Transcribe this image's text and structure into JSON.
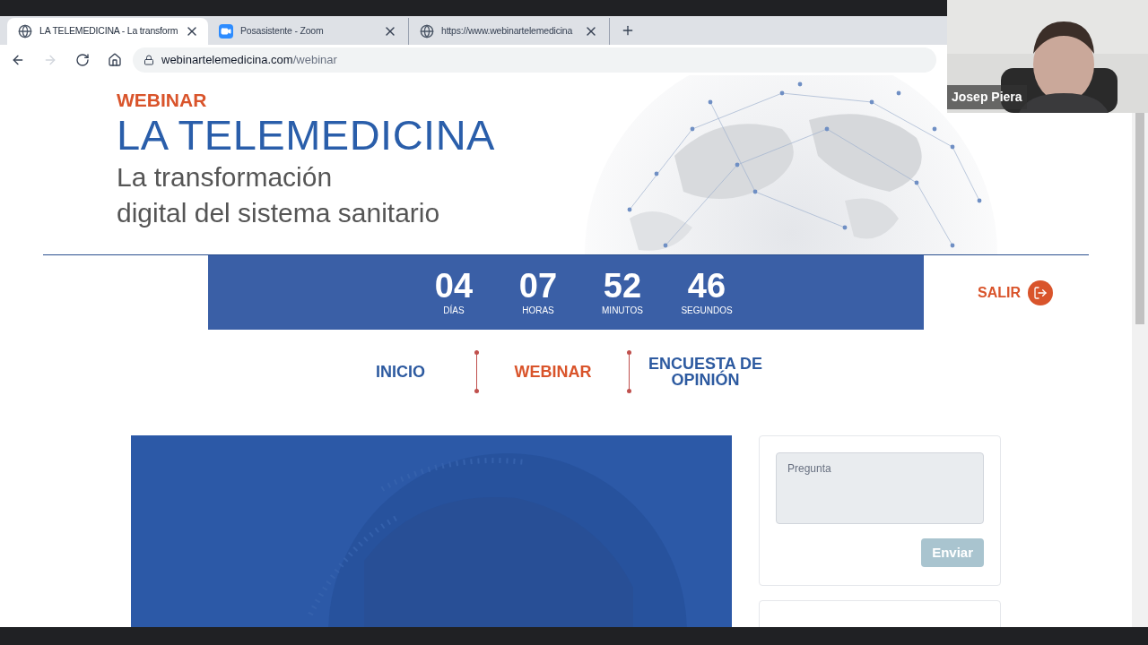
{
  "browser": {
    "tabs": [
      {
        "title": "LA TELEMEDICINA - La transform",
        "kind": "globe",
        "selected": true
      },
      {
        "title": "Posasistente - Zoom",
        "kind": "video",
        "selected": false
      },
      {
        "title": "https://www.webinartelemedicina",
        "kind": "globe",
        "selected": false
      }
    ],
    "address": {
      "host": "webinartelemedicina.com",
      "path": "/webinar"
    }
  },
  "video_tile": {
    "name": "Josep Piera"
  },
  "header": {
    "kicker": "WEBINAR",
    "title": "LA TELEMEDICINA",
    "subtitle_lines": [
      "La transformación",
      "digital del sistema sanitario"
    ]
  },
  "countdown": [
    {
      "value": "04",
      "unit": "DÍAS"
    },
    {
      "value": "07",
      "unit": "HORAS"
    },
    {
      "value": "52",
      "unit": "MINUTOS"
    },
    {
      "value": "46",
      "unit": "SEGUNDOS"
    }
  ],
  "exit_link": "SALIR",
  "nav": [
    {
      "label": "INICIO",
      "selected": false
    },
    {
      "label": "WEBINAR",
      "selected": true
    },
    {
      "label": "ENCUESTA DE OPINIÓN",
      "selected": false
    }
  ],
  "question_form": {
    "placeholder": "Pregunta",
    "submit": {
      "label": "Enviar",
      "disabled": true
    }
  }
}
